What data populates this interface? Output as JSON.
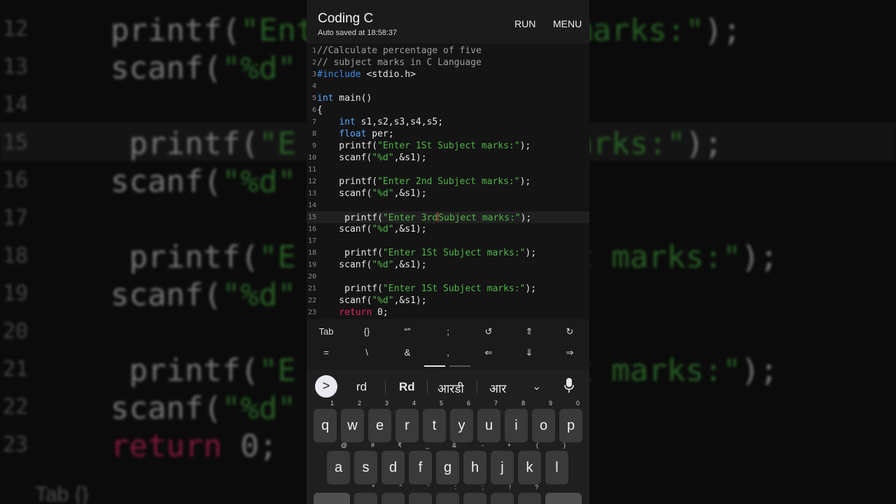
{
  "background": {
    "lines": [
      {
        "num": "12",
        "parts": [
          {
            "t": "printf(",
            "c": ""
          },
          {
            "t": "\"Ent",
            "c": "str"
          },
          {
            "t": "              ",
            "c": ""
          },
          {
            "t": "marks:\"",
            "c": "str"
          },
          {
            "t": ");",
            "c": ""
          }
        ]
      },
      {
        "num": "13",
        "parts": [
          {
            "t": "scanf(",
            "c": ""
          },
          {
            "t": "\"%d\"",
            "c": "str"
          }
        ]
      },
      {
        "num": "14",
        "parts": []
      },
      {
        "num": "15",
        "parts": [
          {
            "t": " printf(",
            "c": ""
          },
          {
            "t": "\"E",
            "c": "str"
          },
          {
            "t": "              ",
            "c": ""
          },
          {
            "t": "marks:\"",
            "c": "str"
          },
          {
            "t": ");",
            "c": ""
          }
        ]
      },
      {
        "num": "16",
        "parts": [
          {
            "t": "scanf(",
            "c": ""
          },
          {
            "t": "\"%d\"",
            "c": "str"
          }
        ]
      },
      {
        "num": "17",
        "parts": []
      },
      {
        "num": "18",
        "parts": [
          {
            "t": " printf(",
            "c": ""
          },
          {
            "t": "\"E",
            "c": "str"
          },
          {
            "t": "               ",
            "c": ""
          },
          {
            "t": "t marks:\"",
            "c": "str"
          },
          {
            "t": ");",
            "c": ""
          }
        ]
      },
      {
        "num": "19",
        "parts": [
          {
            "t": "scanf(",
            "c": ""
          },
          {
            "t": "\"%d\"",
            "c": "str"
          }
        ]
      },
      {
        "num": "20",
        "parts": []
      },
      {
        "num": "21",
        "parts": [
          {
            "t": " printf(",
            "c": ""
          },
          {
            "t": "\"E",
            "c": "str"
          },
          {
            "t": "               ",
            "c": ""
          },
          {
            "t": "t marks:\"",
            "c": "str"
          },
          {
            "t": ");",
            "c": ""
          }
        ]
      },
      {
        "num": "22",
        "parts": [
          {
            "t": "scanf(",
            "c": ""
          },
          {
            "t": "\"%d\"",
            "c": "str"
          }
        ]
      },
      {
        "num": "23",
        "parts": [
          {
            "t": "return",
            "c": "kw"
          },
          {
            "t": " 0;",
            "c": ""
          }
        ]
      }
    ],
    "bottom_text": "Tab         {}"
  },
  "app": {
    "title": "Coding C",
    "subtitle": "Auto saved at 18:58:37",
    "run_label": "RUN",
    "menu_label": "MENU"
  },
  "editor": {
    "current_line": 15,
    "lines": [
      {
        "num": "1",
        "parts": [
          {
            "t": "//Calculate percentage of five",
            "c": "comment"
          }
        ]
      },
      {
        "num": "2",
        "parts": [
          {
            "t": "// subject marks in C Language",
            "c": "comment"
          }
        ]
      },
      {
        "num": "3",
        "parts": [
          {
            "t": "#include",
            "c": "pp"
          },
          {
            "t": " <stdio.h>",
            "c": ""
          }
        ]
      },
      {
        "num": "4",
        "parts": []
      },
      {
        "num": "5",
        "parts": [
          {
            "t": "int",
            "c": "type"
          },
          {
            "t": " main()",
            "c": ""
          }
        ]
      },
      {
        "num": "6",
        "parts": [
          {
            "t": "{",
            "c": ""
          }
        ]
      },
      {
        "num": "7",
        "parts": [
          {
            "t": "    ",
            "c": ""
          },
          {
            "t": "int",
            "c": "type"
          },
          {
            "t": " s1,s2,s3,s4,s5;",
            "c": ""
          }
        ]
      },
      {
        "num": "8",
        "parts": [
          {
            "t": "    ",
            "c": ""
          },
          {
            "t": "float",
            "c": "type"
          },
          {
            "t": " per;",
            "c": ""
          }
        ]
      },
      {
        "num": "9",
        "parts": [
          {
            "t": "    printf(",
            "c": ""
          },
          {
            "t": "\"Enter 1St Subject marks:\"",
            "c": "str"
          },
          {
            "t": ");",
            "c": ""
          }
        ]
      },
      {
        "num": "10",
        "parts": [
          {
            "t": "    scanf(",
            "c": ""
          },
          {
            "t": "\"%d\"",
            "c": "str"
          },
          {
            "t": ",&s1);",
            "c": ""
          }
        ]
      },
      {
        "num": "11",
        "parts": []
      },
      {
        "num": "12",
        "parts": [
          {
            "t": "    printf(",
            "c": ""
          },
          {
            "t": "\"Enter 2nd Subject marks:\"",
            "c": "str"
          },
          {
            "t": ");",
            "c": ""
          }
        ]
      },
      {
        "num": "13",
        "parts": [
          {
            "t": "    scanf(",
            "c": ""
          },
          {
            "t": "\"%d\"",
            "c": "str"
          },
          {
            "t": ",&s1);",
            "c": ""
          }
        ]
      },
      {
        "num": "14",
        "parts": []
      },
      {
        "num": "15",
        "parts": [
          {
            "t": "     printf(",
            "c": ""
          },
          {
            "t": "\"Enter 3rd",
            "c": "str"
          },
          {
            "t": "",
            "c": "caret"
          },
          {
            "t": "Subject marks:\"",
            "c": "str"
          },
          {
            "t": ");",
            "c": ""
          }
        ]
      },
      {
        "num": "16",
        "parts": [
          {
            "t": "    scanf(",
            "c": ""
          },
          {
            "t": "\"%d\"",
            "c": "str"
          },
          {
            "t": ",&s1);",
            "c": ""
          }
        ]
      },
      {
        "num": "17",
        "parts": []
      },
      {
        "num": "18",
        "parts": [
          {
            "t": "     printf(",
            "c": ""
          },
          {
            "t": "\"Enter 1St Subject marks:\"",
            "c": "str"
          },
          {
            "t": ");",
            "c": ""
          }
        ]
      },
      {
        "num": "19",
        "parts": [
          {
            "t": "    scanf(",
            "c": ""
          },
          {
            "t": "\"%d\"",
            "c": "str"
          },
          {
            "t": ",&s1);",
            "c": ""
          }
        ]
      },
      {
        "num": "20",
        "parts": []
      },
      {
        "num": "21",
        "parts": [
          {
            "t": "     printf(",
            "c": ""
          },
          {
            "t": "\"Enter 1St Subject marks:\"",
            "c": "str"
          },
          {
            "t": ");",
            "c": ""
          }
        ]
      },
      {
        "num": "22",
        "parts": [
          {
            "t": "    scanf(",
            "c": ""
          },
          {
            "t": "\"%d\"",
            "c": "str"
          },
          {
            "t": ",&s1);",
            "c": ""
          }
        ]
      },
      {
        "num": "23",
        "parts": [
          {
            "t": "    ",
            "c": ""
          },
          {
            "t": "return",
            "c": "kw"
          },
          {
            "t": " 0;",
            "c": ""
          }
        ]
      }
    ]
  },
  "symbols": {
    "row1": [
      {
        "label": "Tab",
        "name": "tab-key"
      },
      {
        "label": "{}",
        "name": "braces-key"
      },
      {
        "label": "“”",
        "name": "quotes-key"
      },
      {
        "label": ";",
        "name": "semicolon-key"
      },
      {
        "label": "↺",
        "name": "undo-icon"
      },
      {
        "label": "⇑",
        "name": "arrow-up-icon"
      },
      {
        "label": "↻",
        "name": "redo-icon"
      }
    ],
    "row2": [
      {
        "label": "=",
        "name": "equals-key"
      },
      {
        "label": "\\",
        "name": "backslash-key"
      },
      {
        "label": "&",
        "name": "ampersand-key"
      },
      {
        "label": ",",
        "name": "comma-key"
      },
      {
        "label": "⇐",
        "name": "arrow-left-icon"
      },
      {
        "label": "⇓",
        "name": "arrow-down-icon"
      },
      {
        "label": "⇒",
        "name": "arrow-right-icon"
      }
    ]
  },
  "keyboard": {
    "expand_icon": ">",
    "suggestions": [
      "rd",
      "Rd",
      "आरडी",
      "आर"
    ],
    "chevron_icon": "⌄",
    "row1": [
      {
        "k": "q",
        "h": "1"
      },
      {
        "k": "w",
        "h": "2"
      },
      {
        "k": "e",
        "h": "3"
      },
      {
        "k": "r",
        "h": "4"
      },
      {
        "k": "t",
        "h": "5"
      },
      {
        "k": "y",
        "h": "6"
      },
      {
        "k": "u",
        "h": "7"
      },
      {
        "k": "i",
        "h": "8"
      },
      {
        "k": "o",
        "h": "9"
      },
      {
        "k": "p",
        "h": "0"
      }
    ],
    "row2": [
      {
        "k": "a",
        "h": "@"
      },
      {
        "k": "s",
        "h": "#"
      },
      {
        "k": "d",
        "h": "₹"
      },
      {
        "k": "f",
        "h": "_"
      },
      {
        "k": "g",
        "h": "&"
      },
      {
        "k": "h",
        "h": "-"
      },
      {
        "k": "j",
        "h": "+"
      },
      {
        "k": "k",
        "h": "("
      },
      {
        "k": "l",
        "h": ")"
      }
    ],
    "row3": [
      {
        "k": "",
        "h": "*"
      },
      {
        "k": "",
        "h": "\""
      },
      {
        "k": "",
        "h": "'"
      },
      {
        "k": "",
        "h": ":"
      },
      {
        "k": "",
        "h": ";"
      },
      {
        "k": "",
        "h": "!"
      },
      {
        "k": "",
        "h": "?"
      }
    ]
  }
}
